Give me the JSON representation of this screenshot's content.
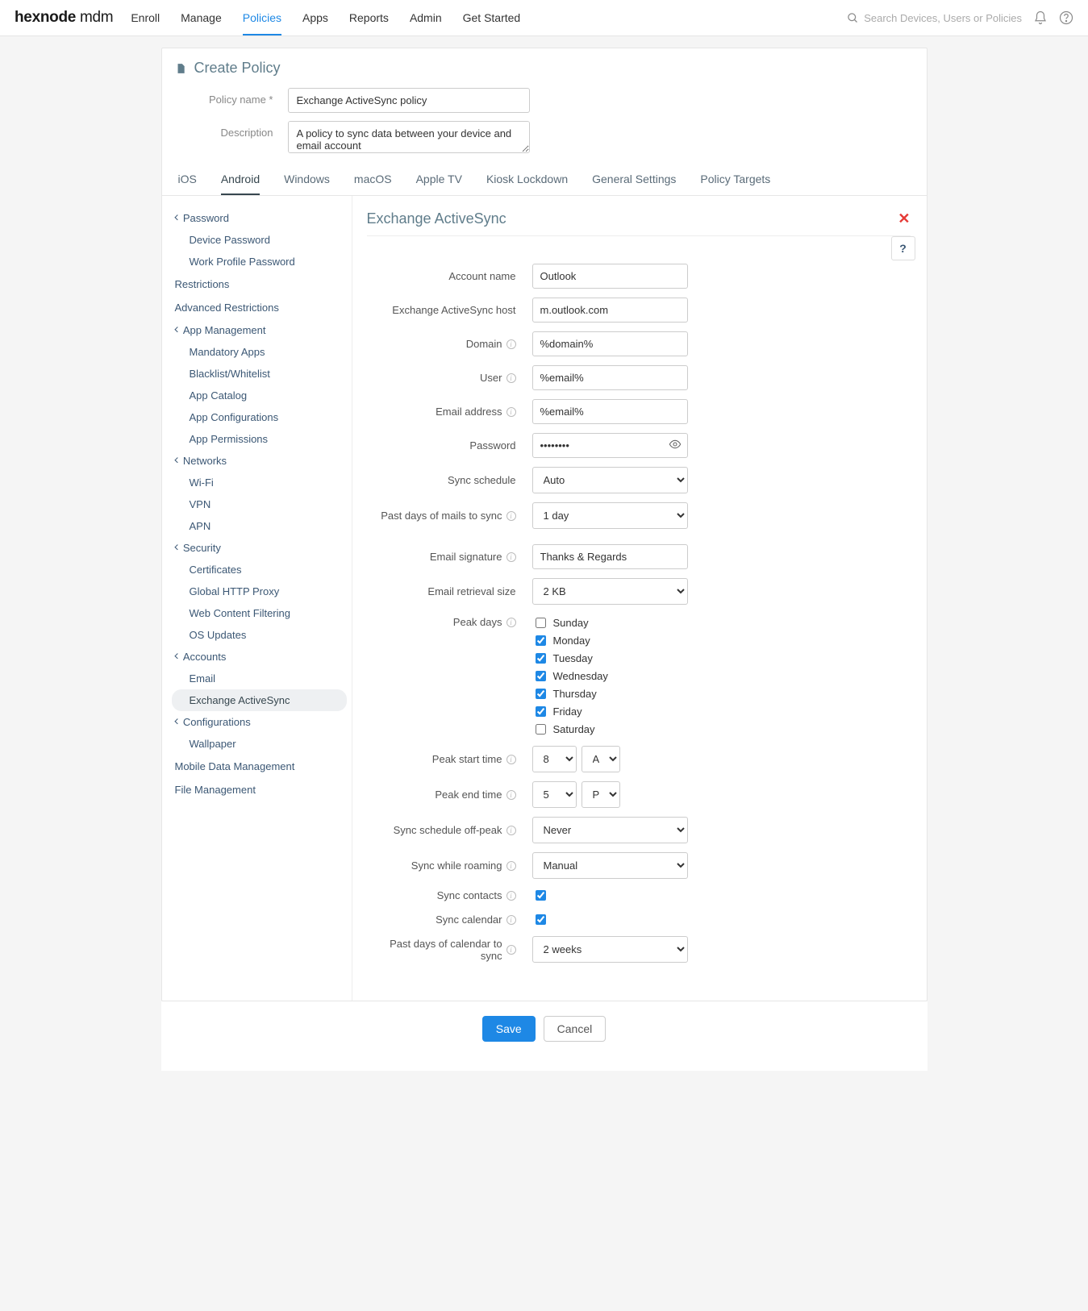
{
  "brand": {
    "bold": "hexnode",
    "light": " mdm"
  },
  "topnav": [
    "Enroll",
    "Manage",
    "Policies",
    "Apps",
    "Reports",
    "Admin",
    "Get Started"
  ],
  "topnav_active": 2,
  "search_placeholder": "Search Devices, Users or Policies",
  "page_title": "Create Policy",
  "meta": {
    "name_label": "Policy name *",
    "name_value": "Exchange ActiveSync policy",
    "desc_label": "Description",
    "desc_value": "A policy to sync data between your device and email account"
  },
  "subtabs": [
    "iOS",
    "Android",
    "Windows",
    "macOS",
    "Apple TV",
    "Kiosk Lockdown",
    "General Settings",
    "Policy Targets"
  ],
  "subtab_active": 1,
  "sidebar": {
    "sections": [
      {
        "label": "Password",
        "children": [
          "Device Password",
          "Work Profile Password"
        ]
      },
      {
        "label": "Restrictions",
        "flat": true
      },
      {
        "label": "Advanced Restrictions",
        "flat": true
      },
      {
        "label": "App Management",
        "children": [
          "Mandatory Apps",
          "Blacklist/Whitelist",
          "App Catalog",
          "App Configurations",
          "App Permissions"
        ]
      },
      {
        "label": "Networks",
        "children": [
          "Wi-Fi",
          "VPN",
          "APN"
        ]
      },
      {
        "label": "Security",
        "children": [
          "Certificates",
          "Global HTTP Proxy",
          "Web Content Filtering",
          "OS Updates"
        ]
      },
      {
        "label": "Accounts",
        "children": [
          "Email",
          "Exchange ActiveSync"
        ],
        "active_child": 1
      },
      {
        "label": "Configurations",
        "children": [
          "Wallpaper"
        ]
      },
      {
        "label": "Mobile Data Management",
        "flat": true
      },
      {
        "label": "File Management",
        "flat": true
      }
    ]
  },
  "content_title": "Exchange ActiveSync",
  "help_char": "?",
  "form": {
    "account_name": {
      "label": "Account name",
      "value": "Outlook"
    },
    "host": {
      "label": "Exchange ActiveSync host",
      "value": "m.outlook.com"
    },
    "domain": {
      "label": "Domain",
      "value": "%domain%",
      "info": true
    },
    "user": {
      "label": "User",
      "value": "%email%",
      "info": true
    },
    "email": {
      "label": "Email address",
      "value": "%email%",
      "info": true
    },
    "password": {
      "label": "Password",
      "value": "••••••••"
    },
    "sync_schedule": {
      "label": "Sync schedule",
      "value": "Auto"
    },
    "past_mail": {
      "label": "Past days of mails to sync",
      "value": "1 day",
      "info": true
    },
    "signature": {
      "label": "Email signature",
      "value": "Thanks & Regards",
      "info": true
    },
    "retrieval": {
      "label": "Email retrieval size",
      "value": "2 KB"
    },
    "peak_days": {
      "label": "Peak days",
      "info": true,
      "days": [
        {
          "name": "Sunday",
          "checked": false
        },
        {
          "name": "Monday",
          "checked": true
        },
        {
          "name": "Tuesday",
          "checked": true
        },
        {
          "name": "Wednesday",
          "checked": true
        },
        {
          "name": "Thursday",
          "checked": true
        },
        {
          "name": "Friday",
          "checked": true
        },
        {
          "name": "Saturday",
          "checked": false
        }
      ]
    },
    "peak_start": {
      "label": "Peak start time",
      "hour": "8",
      "ampm": "AM",
      "info": true
    },
    "peak_end": {
      "label": "Peak end time",
      "hour": "5",
      "ampm": "PM",
      "info": true
    },
    "offpeak": {
      "label": "Sync schedule off-peak",
      "value": "Never",
      "info": true
    },
    "roaming": {
      "label": "Sync while roaming",
      "value": "Manual",
      "info": true
    },
    "sync_contacts": {
      "label": "Sync contacts",
      "checked": true,
      "info": true
    },
    "sync_calendar": {
      "label": "Sync calendar",
      "checked": true,
      "info": true
    },
    "past_calendar": {
      "label": "Past days of calendar to sync",
      "value": "2 weeks",
      "info": true
    }
  },
  "buttons": {
    "save": "Save",
    "cancel": "Cancel"
  }
}
